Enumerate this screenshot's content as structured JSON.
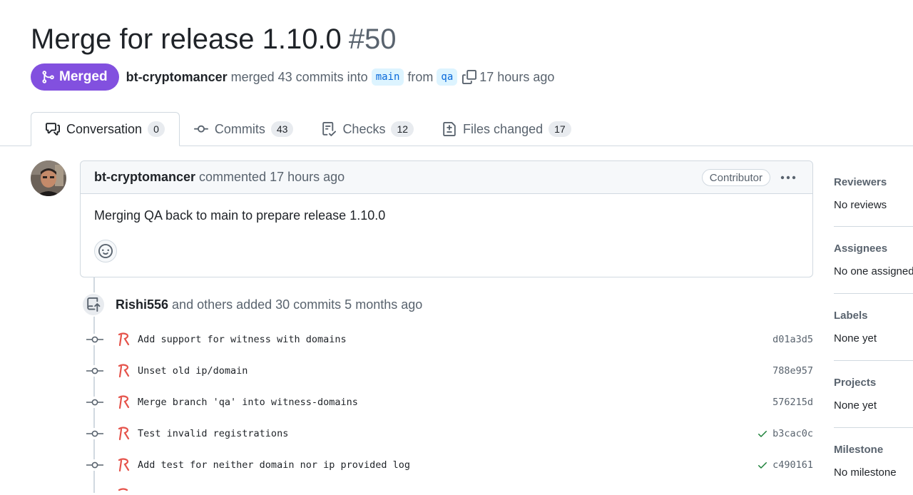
{
  "pr": {
    "title": "Merge for release 1.10.0",
    "number": "#50",
    "state_label": "Merged",
    "author": "bt-cryptomancer",
    "merge_text_pre": "merged 43 commits into",
    "base_branch": "main",
    "from_text": "from",
    "head_branch": "qa",
    "time": "17 hours ago"
  },
  "tabs": [
    {
      "label": "Conversation",
      "count": "0",
      "icon": "comment-discussion-icon"
    },
    {
      "label": "Commits",
      "count": "43",
      "icon": "git-commit-icon"
    },
    {
      "label": "Checks",
      "count": "12",
      "icon": "checklist-icon"
    },
    {
      "label": "Files changed",
      "count": "17",
      "icon": "file-diff-icon"
    }
  ],
  "comment": {
    "author": "bt-cryptomancer",
    "meta": "commented 17 hours ago",
    "role_badge": "Contributor",
    "body": "Merging QA back to main to prepare release 1.10.0"
  },
  "push_event": {
    "author": "Rishi556",
    "text": "and others added 30 commits 5 months ago"
  },
  "commits": [
    {
      "message": "Add support for witness with domains",
      "sha": "d01a3d5",
      "status": "none"
    },
    {
      "message": "Unset old ip/domain",
      "sha": "788e957",
      "status": "none"
    },
    {
      "message": "Merge branch 'qa' into witness-domains",
      "sha": "576215d",
      "status": "none"
    },
    {
      "message": "Test invalid registrations",
      "sha": "b3cac0c",
      "status": "success"
    },
    {
      "message": "Add test for neither domain nor ip provided log",
      "sha": "c490161",
      "status": "success"
    }
  ],
  "sidebar": {
    "reviewers": {
      "title": "Reviewers",
      "value": "No reviews"
    },
    "assignees": {
      "title": "Assignees",
      "value": "No one assigned"
    },
    "labels": {
      "title": "Labels",
      "value": "None yet"
    },
    "projects": {
      "title": "Projects",
      "value": "None yet"
    },
    "milestone": {
      "title": "Milestone",
      "value": "No milestone"
    }
  },
  "colors": {
    "merged": "#8250df",
    "branch_bg": "#ddf4ff",
    "branch_fg": "#0969da",
    "success": "#1a7f37",
    "avatar_accent": "#e5534b"
  }
}
